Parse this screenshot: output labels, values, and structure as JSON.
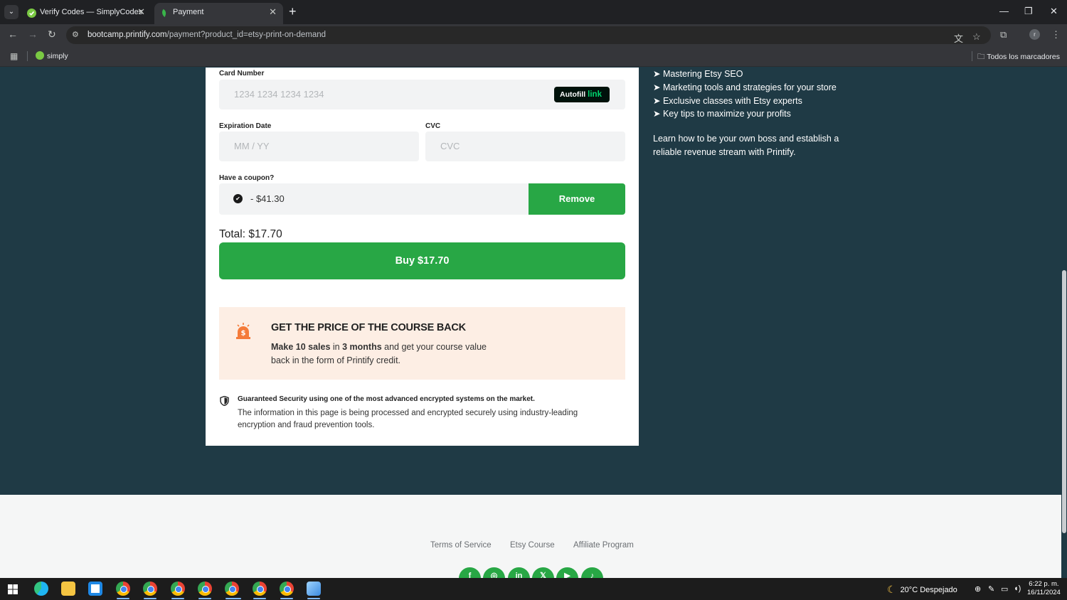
{
  "browser": {
    "tabs": [
      {
        "title": "Verify Codes — SimplyCodes",
        "active": false
      },
      {
        "title": "Payment",
        "active": true
      }
    ],
    "url_host": "bootcamp.printify.com",
    "url_path": "/payment?product_id=etsy-print-on-demand",
    "profile_initial": "r",
    "bookmarks": [
      {
        "label": "simply"
      }
    ],
    "all_bookmarks_label": "Todos los marcadores"
  },
  "payment": {
    "card_number_label": "Card Number",
    "card_number_placeholder": "1234 1234 1234 1234",
    "autofill_label": "Autofill",
    "autofill_brand": "link",
    "expiration_label": "Expiration Date",
    "expiration_placeholder": "MM / YY",
    "cvc_label": "CVC",
    "cvc_placeholder": "CVC",
    "coupon_label": "Have a coupon?",
    "coupon_value": "- $41.30",
    "remove_label": "Remove",
    "total_label": "Total: $17.70",
    "buy_label": "Buy $17.70"
  },
  "promo": {
    "title": "GET THE PRICE OF THE COURSE BACK",
    "text_part1": "Make 10 sales",
    "text_part2": " in ",
    "text_part3": "3 months",
    "text_part4": " and get your course value back in the form of Printify credit."
  },
  "security": {
    "title": "Guaranteed Security using one of the most advanced encrypted systems on the market.",
    "text": "The information in this page is being processed and encrypted securely using industry-leading encryption and fraud prevention tools."
  },
  "features": {
    "items": [
      "➤ Mastering Etsy SEO",
      "➤ Marketing tools and strategies for your store",
      "➤ Exclusive classes with Etsy experts",
      "➤ Key tips to maximize your profits"
    ],
    "learn_text": "Learn how to be your own boss and establish a reliable revenue stream with Printify."
  },
  "footer": {
    "links": [
      "Terms of Service",
      "Etsy Course",
      "Affiliate Program"
    ],
    "social": [
      "facebook",
      "instagram",
      "linkedin",
      "x",
      "youtube",
      "tiktok"
    ]
  },
  "taskbar": {
    "weather": "20°C  Despejado",
    "time": "6:22 p. m.",
    "date": "16/11/2024"
  },
  "colors": {
    "primary_green": "#28a745",
    "page_background": "#1f3a45",
    "promo_background": "#fdeee4"
  }
}
